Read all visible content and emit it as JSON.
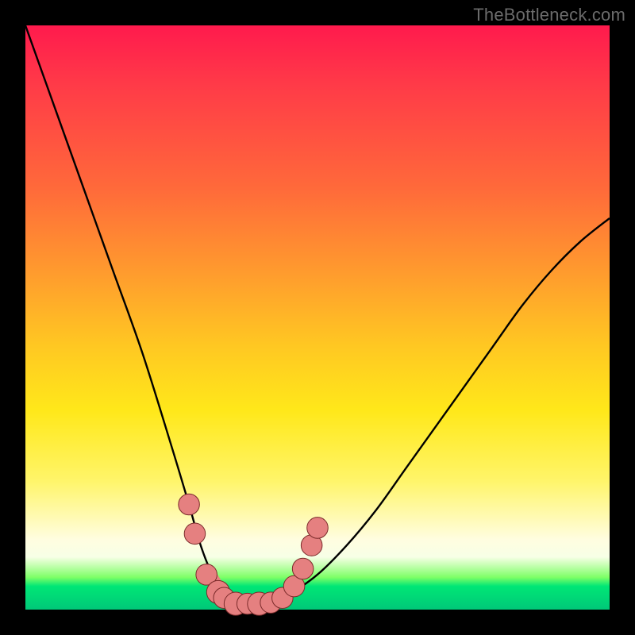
{
  "watermark": "TheBottleneck.com",
  "colors": {
    "frame": "#000000",
    "curve": "#000000",
    "markers_fill": "#e58080",
    "markers_stroke": "#7a2a2a"
  },
  "chart_data": {
    "type": "line",
    "title": "",
    "xlabel": "",
    "ylabel": "",
    "xlim": [
      0,
      100
    ],
    "ylim": [
      0,
      100
    ],
    "grid": false,
    "legend": false,
    "series": [
      {
        "name": "bottleneck-curve",
        "x": [
          0,
          5,
          10,
          15,
          20,
          25,
          28,
          30,
          32,
          34,
          36,
          38,
          40,
          42,
          45,
          50,
          55,
          60,
          65,
          70,
          75,
          80,
          85,
          90,
          95,
          100
        ],
        "y": [
          100,
          86,
          72,
          58,
          44,
          28,
          18,
          11,
          6,
          3,
          1.5,
          1,
          1,
          1.2,
          2.5,
          6,
          11,
          17,
          24,
          31,
          38,
          45,
          52,
          58,
          63,
          67
        ]
      }
    ],
    "markers": [
      {
        "x": 28,
        "y": 18,
        "r": 1.4
      },
      {
        "x": 29,
        "y": 13,
        "r": 1.4
      },
      {
        "x": 31,
        "y": 6,
        "r": 1.4
      },
      {
        "x": 33,
        "y": 3,
        "r": 1.6
      },
      {
        "x": 34,
        "y": 2,
        "r": 1.4
      },
      {
        "x": 36,
        "y": 1,
        "r": 1.6
      },
      {
        "x": 38,
        "y": 1,
        "r": 1.4
      },
      {
        "x": 40,
        "y": 1,
        "r": 1.6
      },
      {
        "x": 42,
        "y": 1.2,
        "r": 1.4
      },
      {
        "x": 44,
        "y": 2,
        "r": 1.4
      },
      {
        "x": 46,
        "y": 4,
        "r": 1.4
      },
      {
        "x": 47.5,
        "y": 7,
        "r": 1.4
      },
      {
        "x": 49,
        "y": 11,
        "r": 1.4
      },
      {
        "x": 50,
        "y": 14,
        "r": 1.4
      }
    ]
  }
}
